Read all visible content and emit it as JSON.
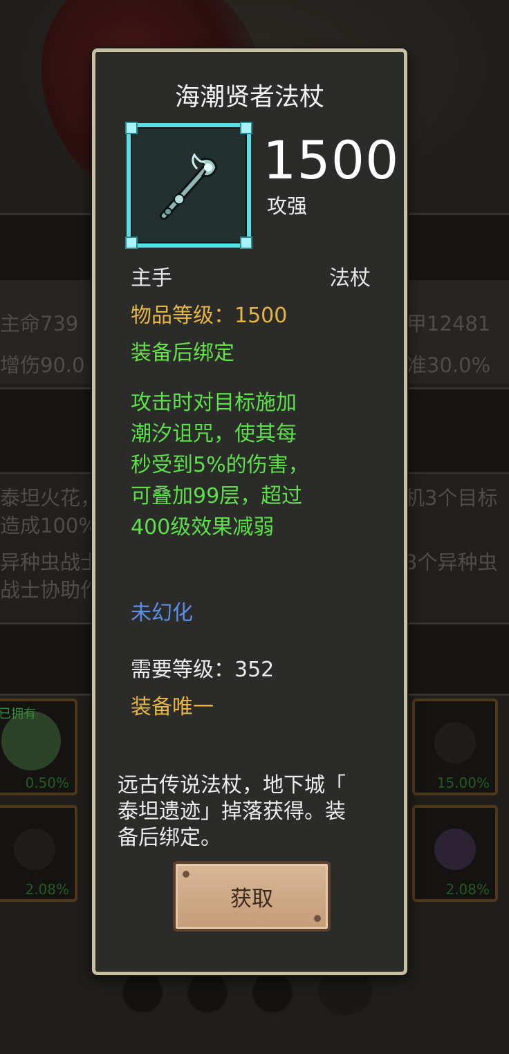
{
  "background": {
    "stats_left": [
      "主命739",
      "增伤90.0"
    ],
    "stats_right": [
      "甲12481",
      "准30.0%"
    ],
    "skills_left": [
      "泰坦火花，",
      "造成100%",
      "异种虫战士",
      "战士协助作"
    ],
    "skills_right": [
      "机3个目标",
      "3个异种虫"
    ],
    "drops": [
      {
        "percent": "0.50%",
        "label": "已拥有"
      },
      {
        "percent": "15.00%"
      },
      {
        "percent": "2.08%"
      },
      {
        "percent": "2.08%"
      }
    ]
  },
  "item": {
    "name": "海潮贤者法杖",
    "icon": "staff-icon",
    "power_value": "1500",
    "power_label": "攻强",
    "slot": "主手",
    "weapon_type": "法杖",
    "item_level": "物品等级：1500",
    "bind_text": "装备后绑定",
    "effect": "攻击时对目标施加潮汐诅咒，使其每秒受到5%的伤害，可叠加99层，超过400级效果减弱",
    "effect_lines": [
      "攻击时对目标施加",
      "潮汐诅咒，使其每",
      "秒受到5%的伤害，",
      "可叠加99层，超过",
      "400级效果减弱"
    ],
    "transmog": "未幻化",
    "required_level": "需要等级：352",
    "unique": "装备唯一",
    "flavor_lines": [
      "远古传说法杖，地下城「",
      "泰坦遗迹」掉落获得。装",
      "备后绑定。"
    ],
    "get_button": "获取"
  },
  "colors": {
    "frame_rare": "#56e0e6",
    "item_level": "#e7b544",
    "effect_green": "#5ee04a",
    "transmog_blue": "#5b8fe6"
  }
}
